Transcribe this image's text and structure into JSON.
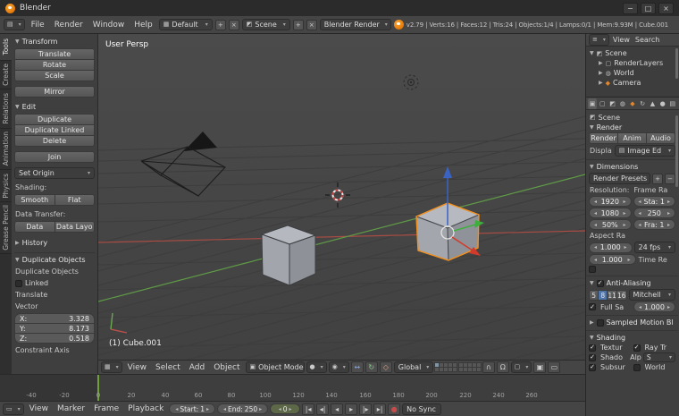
{
  "titlebar": {
    "title": "Blender",
    "minimize": "−",
    "maximize": "□",
    "close": "×"
  },
  "topbar": {
    "menus": [
      "File",
      "Render",
      "Window",
      "Help"
    ],
    "layout_value": "Default",
    "scene_value": "Scene",
    "engine_value": "Blender Render",
    "add": "+",
    "remove": "×",
    "stats": "v2.79 | Verts:16 | Faces:12 | Tris:24 | Objects:1/4 | Lamps:0/1 | Mem:9.93M | Cube.001"
  },
  "tool_tabs": {
    "items": [
      "Tools",
      "Create",
      "Relations",
      "Animation",
      "Physics",
      "Grease Pencil"
    ]
  },
  "toolshelf": {
    "transform_title": "Transform",
    "translate": "Translate",
    "rotate": "Rotate",
    "scale": "Scale",
    "mirror": "Mirror",
    "edit_title": "Edit",
    "duplicate": "Duplicate",
    "duplicate_linked": "Duplicate Linked",
    "delete": "Delete",
    "join": "Join",
    "set_origin": "Set Origin",
    "shading_label": "Shading:",
    "smooth": "Smooth",
    "flat": "Flat",
    "data_transfer_label": "Data Transfer:",
    "data": "Data",
    "data_layout": "Data Layo",
    "history_title": "History",
    "redo_title": "Duplicate Objects",
    "redo_op": "Duplicate Objects",
    "linked_label": "Linked",
    "translate_label": "Translate",
    "vector_label": "Vector",
    "x_label": "X:",
    "x_value": "3.328",
    "y_label": "Y:",
    "y_value": "8.173",
    "z_label": "Z:",
    "z_value": "0.518",
    "constraint_label": "Constraint Axis"
  },
  "viewport": {
    "view_label": "User Persp",
    "object_label": "(1) Cube.001"
  },
  "vp_header": {
    "menus": [
      "View",
      "Select",
      "Add",
      "Object"
    ],
    "mode_value": "Object Mode",
    "orientation_value": "Global"
  },
  "timeline": {
    "ticks": [
      "-40",
      "-20",
      "0",
      "20",
      "40",
      "60",
      "80",
      "100",
      "120",
      "140",
      "160",
      "180",
      "200",
      "220",
      "240",
      "260"
    ],
    "menus": [
      "View",
      "Marker",
      "Frame",
      "Playback"
    ],
    "start_label": "Start:",
    "start_value": "1",
    "end_label": "End:",
    "end_value": "250",
    "frame_value": "0",
    "sync_value": "No Sync"
  },
  "outliner": {
    "menus": [
      "View",
      "Search"
    ],
    "scene_label": "Scene",
    "items": [
      "RenderLayers",
      "World",
      "Camera"
    ]
  },
  "properties": {
    "context_value": "Scene",
    "render_title": "Render",
    "render_btn": "Render",
    "anim_btn": "Anim",
    "audio_btn": "Audio",
    "display_label": "Displa",
    "display_value": "Image Ed",
    "dimensions_title": "Dimensions",
    "presets_value": "Render Presets",
    "resolution_label": "Resolution:",
    "frame_label": "Frame Ra",
    "res_x": "1920",
    "res_y": "1080",
    "res_pct": "50%",
    "fr_start": "Sta: 1",
    "fr_end": "250",
    "fr_step": "Fra: 1",
    "aspect_label": "Aspect Ra",
    "asp_x": "1.000",
    "asp_y": "1.000",
    "fps_value": "24 fps",
    "time_label": "Time Re",
    "aa_title": "Anti-Aliasing",
    "aa_samples": [
      "5",
      "8",
      "11",
      "16"
    ],
    "aa_filter": "Mitchell",
    "full_sample": "Full Sa",
    "aa_size": "1.000",
    "motion_title": "Sampled Motion Bl",
    "shading_title": "Shading",
    "textures": "Textur",
    "raytrace": "Ray Tr",
    "shadows": "Shado",
    "alpha_label": "Alp",
    "alpha_value": "S",
    "subsurface": "Subsur",
    "world": "World"
  },
  "icons": {
    "list": "▤",
    "grid": "▦",
    "bar": "▭",
    "tree": "≡",
    "sphere": "●",
    "pivot": "◉",
    "cube": "▣",
    "diamond": "◆",
    "page": "▢",
    "globe": "◍",
    "scene": "◩",
    "tri_up": "▲",
    "arrows_h": "↔",
    "rotate": "↻",
    "scale": "◇",
    "magnet": "Ω",
    "lock": "∩",
    "plus": "+",
    "minus": "−",
    "rec": "●",
    "pb": [
      "|◂",
      "◂|",
      "◂",
      "▸",
      "|▸",
      "▸|"
    ]
  },
  "colors": {
    "selection_outline": "#f5921e",
    "axis_x": "#a84c44",
    "axis_y": "#5f9b47",
    "axis_z": "#3b63c4",
    "playhead": "#6fa03a"
  }
}
